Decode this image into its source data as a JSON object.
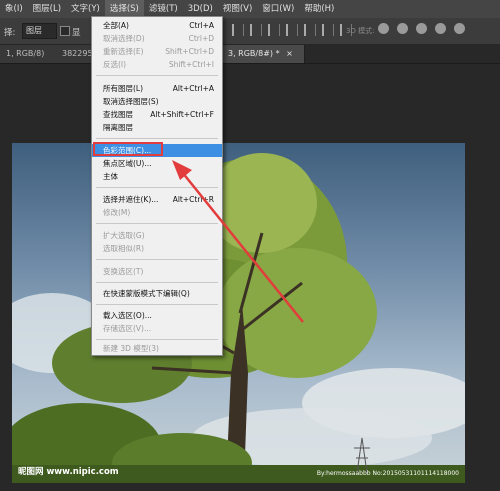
{
  "menubar": {
    "items": [
      "象(I)",
      "图层(L)",
      "文字(Y)",
      "选择(S)",
      "滤镜(T)",
      "3D(D)",
      "视图(V)",
      "窗口(W)",
      "帮助(H)"
    ]
  },
  "options": {
    "label": "择:",
    "layer_select": "图层",
    "checkbox_label": "显",
    "mode3d": "3D 模式:"
  },
  "tabs": {
    "tab1": "1, RGB/8)",
    "tab2": "382295",
    "tab3": "3, RGB/8#) *",
    "close": "×"
  },
  "menu": {
    "all": {
      "label": "全部(A)",
      "shortcut": "Ctrl+A"
    },
    "deselect": {
      "label": "取消选择(D)",
      "shortcut": "Ctrl+D"
    },
    "reselect": {
      "label": "重新选择(E)",
      "shortcut": "Shift+Ctrl+D"
    },
    "inverse": {
      "label": "反选(I)",
      "shortcut": "Shift+Ctrl+I"
    },
    "all_layers": {
      "label": "所有图层(L)",
      "shortcut": "Alt+Ctrl+A"
    },
    "deselect_layers": {
      "label": "取消选择图层(S)"
    },
    "find_layers": {
      "label": "查找图层",
      "shortcut": "Alt+Shift+Ctrl+F"
    },
    "isolate_layers": {
      "label": "隔离图层"
    },
    "color_range": {
      "label": "色彩范围(C)..."
    },
    "focus_area": {
      "label": "焦点区域(U)..."
    },
    "subject": {
      "label": "主体"
    },
    "select_mask": {
      "label": "选择并遮住(K)...",
      "shortcut": "Alt+Ctrl+R"
    },
    "modify": {
      "label": "修改(M)"
    },
    "grow": {
      "label": "扩大选取(G)"
    },
    "similar": {
      "label": "选取相似(R)"
    },
    "transform": {
      "label": "变换选区(T)"
    },
    "quick_mask": {
      "label": "在快速蒙版模式下编辑(Q)"
    },
    "load": {
      "label": "载入选区(O)..."
    },
    "save": {
      "label": "存储选区(V)..."
    },
    "new3d": {
      "label": "新建 3D 模型(3)"
    }
  },
  "watermark": {
    "left": "昵图网 www.nipic.com",
    "right": "By:hermossaabbb No:20150531101114118000"
  },
  "colors": {
    "highlight": "#3d8fe3",
    "annotation": "#e23c3c",
    "menubar": "#454545"
  }
}
